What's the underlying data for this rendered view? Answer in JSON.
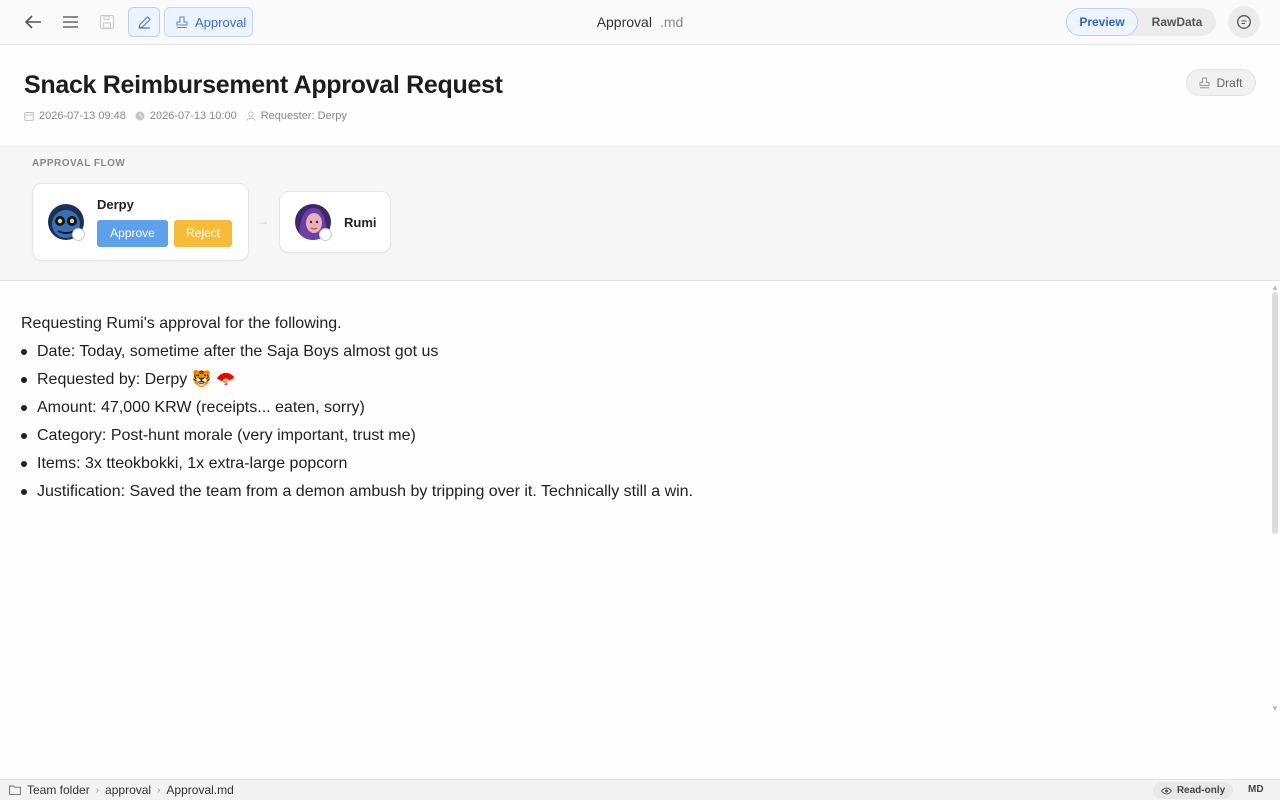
{
  "toolbar": {
    "approval_label": "Approval",
    "doc_name": "Approval",
    "doc_ext": ".md",
    "preview_label": "Preview",
    "rawdata_label": "RawData"
  },
  "header": {
    "title": "Snack Reimbursement Approval Request",
    "created": "2026-07-13 09:48",
    "modified": "2026-07-13 10:00",
    "requester": "Requester: Derpy",
    "status": "Draft"
  },
  "flow": {
    "label": "APPROVAL FLOW",
    "approvers": [
      {
        "name": "Derpy",
        "approve_label": "Approve",
        "reject_label": "Reject"
      },
      {
        "name": "Rumi"
      }
    ],
    "arrow": "→"
  },
  "content": {
    "intro": "Requesting Rumi's approval for the following.",
    "items": [
      "Date: Today, sometime after the Saja Boys almost got us",
      "Requested by: Derpy 🐯 🪭",
      "Amount: 47,000 KRW (receipts... eaten, sorry)",
      "Category: Post-hunt morale (very important, trust me)",
      "Items: 3x tteokbokki, 1x extra-large popcorn",
      "Justification: Saved the team from a demon ambush by tripping over it. Technically still a win."
    ]
  },
  "statusbar": {
    "path": [
      "Team folder",
      "approval",
      "Approval.md"
    ],
    "readonly_label": "Read-only",
    "format": "MD"
  },
  "colors": {
    "accent": "#2f67c4",
    "approve": "#5ea0ec",
    "reject": "#f5bc3a"
  }
}
